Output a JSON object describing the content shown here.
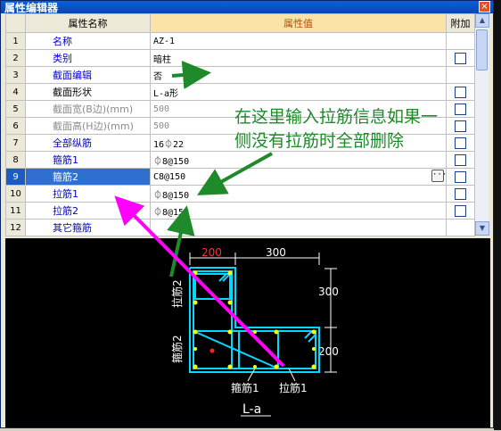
{
  "window": {
    "title": "属性编辑器",
    "close_glyph": "×"
  },
  "grid": {
    "headers": {
      "name": "属性名称",
      "value": "属性值",
      "attach": "附加"
    },
    "rows": [
      {
        "no": "1",
        "name": "名称",
        "value": "AZ-1"
      },
      {
        "no": "2",
        "name": "类别",
        "value": "暗柱"
      },
      {
        "no": "3",
        "name": "截面编辑",
        "value": "否"
      },
      {
        "no": "4",
        "name": "截面形状",
        "value": "L-a形"
      },
      {
        "no": "5",
        "name": "截面宽(B边)(mm)",
        "value": "500"
      },
      {
        "no": "6",
        "name": "截面高(H边)(mm)",
        "value": "500"
      },
      {
        "no": "7",
        "name": "全部纵筋",
        "value": "16⏀22"
      },
      {
        "no": "8",
        "name": "箍筋1",
        "value": "⏀8@150"
      },
      {
        "no": "9",
        "name": "箍筋2",
        "value": "C8@150"
      },
      {
        "no": "10",
        "name": "拉筋1",
        "value": "⏀8@150"
      },
      {
        "no": "11",
        "name": "拉筋2",
        "value": "⏀8@150"
      },
      {
        "no": "12",
        "name": "其它箍筋",
        "value": ""
      }
    ],
    "ellipsis": "···"
  },
  "annotation": {
    "line1": "在这里输入拉筋信息如果一",
    "line2": "侧没有拉筋时全部删除"
  },
  "drawing": {
    "dim_top_left": "200",
    "dim_top_right": "300",
    "dim_right_top": "300",
    "dim_right_bottom": "200",
    "label_tie2": "拉筋2",
    "label_stirrup2": "箍筋2",
    "label_stirrup1": "箍筋1",
    "label_tie1": "拉筋1",
    "shape_label": "L-a",
    "colors": {
      "steel": "#00d8ff",
      "rebar": "#ffff00",
      "dim": "#ffffff",
      "red": "#ff3030"
    }
  }
}
